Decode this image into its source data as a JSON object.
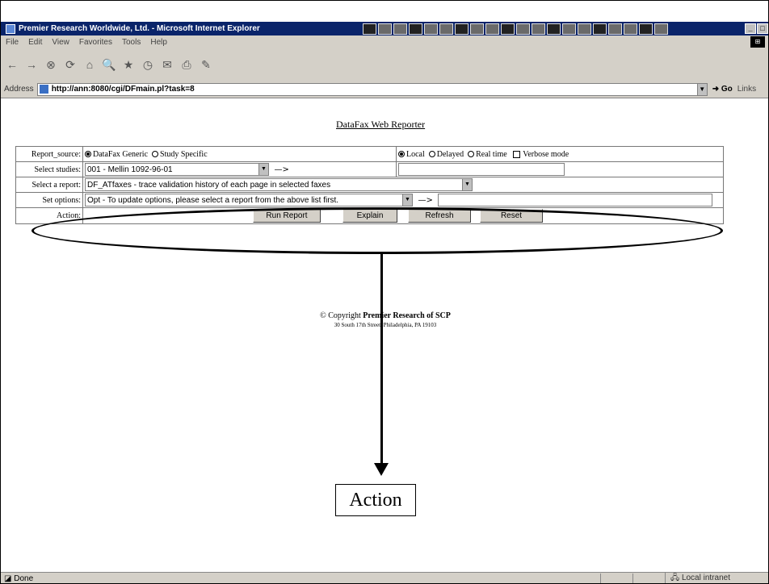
{
  "window": {
    "title": "Premier Research Worldwide, Ltd. - Microsoft Internet Explorer",
    "taskbar_icons": [
      "chart-icon",
      "tile-icon",
      "grid-icon",
      "doc-icon",
      "paint-icon",
      "clip-icon",
      "close-icon",
      "apps-icon",
      "chart-icon",
      "app-icon",
      "clip-icon",
      "store-icon",
      "circle-icon",
      "tool-icon",
      "type-icon",
      "dock-icon",
      "quit-icon",
      "circle-icon",
      "at-icon",
      "clip-icon"
    ],
    "controls": [
      "_",
      "□"
    ]
  },
  "menubar": {
    "items": [
      "File",
      "Edit",
      "View",
      "Favorites",
      "Tools",
      "Help"
    ]
  },
  "toolbar": {
    "buttons": [
      "←",
      "→",
      "⊗",
      "⟳",
      "⌂",
      "🔍",
      "★",
      "◷",
      "✉",
      "⎙",
      "✎"
    ]
  },
  "address": {
    "label": "Address",
    "url": "http://ann:8080/cgi/DFmain.pl?task=8",
    "go_label": "Go",
    "links_label": "Links"
  },
  "page": {
    "title": "DataFax Web Reporter",
    "form": {
      "report_source_label": "Report_source:",
      "source_options": [
        "DataFax Generic",
        "Study Specific"
      ],
      "source_selected": 0,
      "mode_options": [
        "Local",
        "Delayed",
        "Real time"
      ],
      "mode_selected": 0,
      "verbose_label": "Verbose mode",
      "select_studies_label": "Select studies:",
      "study_value": "001 - Mellin 1092-96-01",
      "arrow_symbol": "—>",
      "select_report_label": "Select a report:",
      "report_value": "DF_ATfaxes    - trace validation history of each page in selected faxes",
      "set_options_label": "Set options:",
      "options_value": "Opt - To update options, please select a report from the above list first.",
      "action_label": "Action:",
      "buttons": {
        "run": "Run Report",
        "explain": "Explain",
        "refresh": "Refresh",
        "reset": "Reset"
      }
    },
    "copyright": {
      "line1_prefix": "© Copyright ",
      "line1_bold": "Premier Research of SCP",
      "line2": "30 South 17th Street, Philadelphia, PA 19103"
    },
    "callout_label": "Action"
  },
  "status": {
    "text": "Done",
    "zone": "Local intranet"
  }
}
